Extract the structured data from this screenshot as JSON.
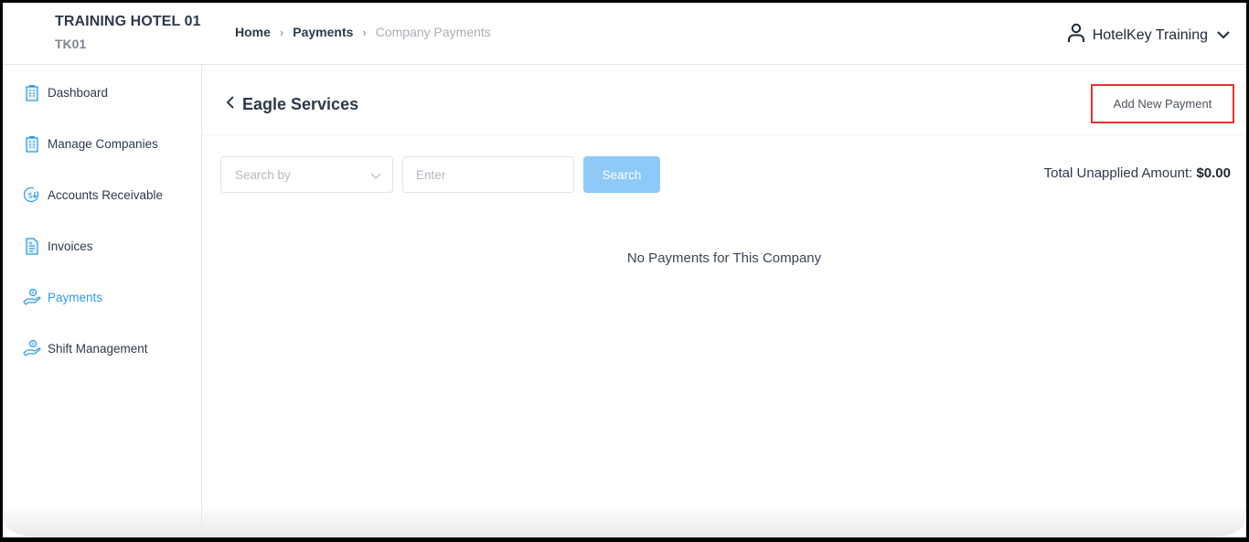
{
  "header": {
    "hotel_name": "TRAINING HOTEL 01",
    "hotel_code": "TK01",
    "breadcrumb": [
      {
        "label": "Home"
      },
      {
        "label": "Payments"
      },
      {
        "label": "Company Payments"
      }
    ],
    "user": {
      "name": "HotelKey Training",
      "icon": "user-icon"
    }
  },
  "sidebar": {
    "items": [
      {
        "label": "Dashboard",
        "icon": "building-icon",
        "active": false
      },
      {
        "label": "Manage Companies",
        "icon": "building-icon",
        "active": false
      },
      {
        "label": "Accounts Receivable",
        "icon": "dollar-circle-icon",
        "active": false
      },
      {
        "label": "Invoices",
        "icon": "document-icon",
        "active": false
      },
      {
        "label": "Payments",
        "icon": "hand-coin-icon",
        "active": true
      },
      {
        "label": "Shift Management",
        "icon": "hand-coin-icon",
        "active": false
      }
    ]
  },
  "main": {
    "title": "Eagle Services",
    "add_button": "Add New Payment",
    "filters": {
      "search_by_placeholder": "Search by",
      "input_placeholder": "Enter",
      "search_button": "Search"
    },
    "total": {
      "label": "Total Unapplied Amount:",
      "value": "$0.00"
    },
    "empty_message": "No Payments for This Company"
  },
  "colors": {
    "accent": "#2e9ce6",
    "search_button": "#8ec9f8",
    "highlight_border": "#e8322a",
    "text": "#2c3a4b"
  }
}
